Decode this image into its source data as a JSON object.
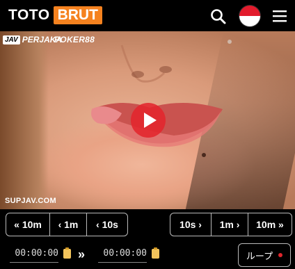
{
  "header": {
    "logo_left": "TOTO",
    "logo_right": "BRUT",
    "brand_color": "#f5821f",
    "search_icon": "search-icon",
    "flag_icon": "indonesia-flag-icon",
    "menu_icon": "hamburger-menu-icon"
  },
  "video": {
    "jav_badge": "JAV",
    "jav_label": "PERJAKA",
    "poker_label": "POKER88",
    "watermark": "SUPJAV.COM",
    "play_icon": "play-icon",
    "play_color": "#e2262d"
  },
  "seek_back": [
    "« 10m",
    "‹ 1m",
    "‹ 10s"
  ],
  "seek_forward": [
    "10s ›",
    "1m ›",
    "10m »"
  ],
  "time_controls": {
    "start_time": "00:00:00",
    "end_time": "00:00:00",
    "arrow": "»",
    "loop_label": "ループ"
  }
}
